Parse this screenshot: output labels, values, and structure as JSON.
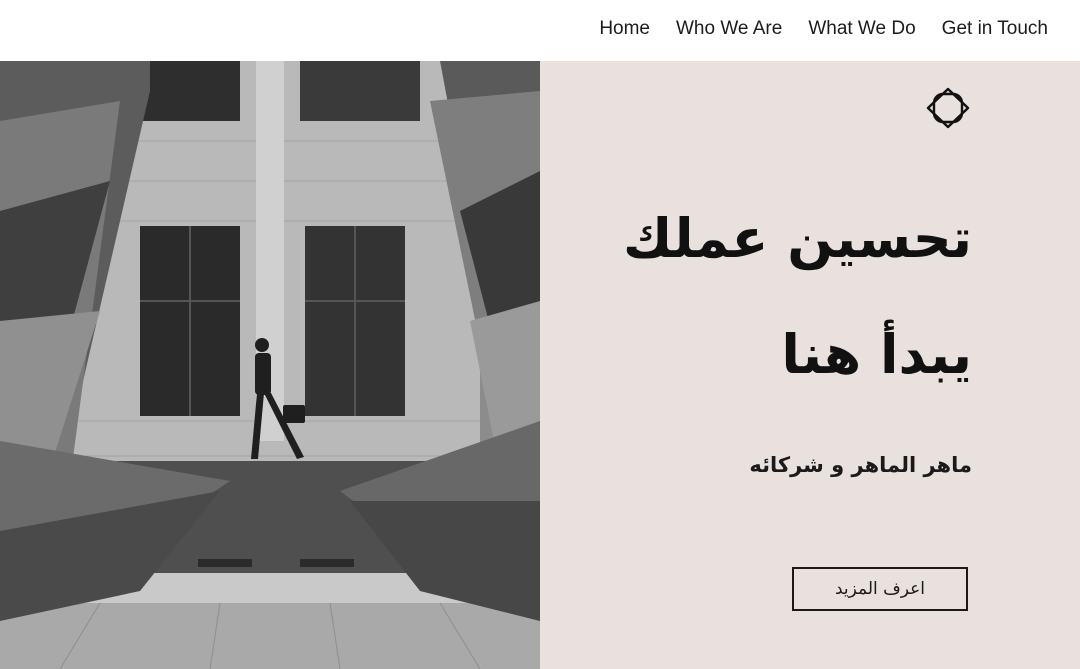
{
  "nav": {
    "items": [
      {
        "label": "Home"
      },
      {
        "label": "Who We Are"
      },
      {
        "label": "What We Do"
      },
      {
        "label": "Get in Touch"
      }
    ]
  },
  "hero": {
    "headline_line1": "تحسين عملك",
    "headline_line2": "يبدأ هنا",
    "subtitle": "ماهر الماهر و شركائه",
    "cta_label": "اعرف المزيد",
    "logo_icon": "rounded-diamond-logo-icon",
    "background_color": "#e8e1dd",
    "text_color": "#111111"
  },
  "image": {
    "description_icon": "architecture-photo"
  }
}
